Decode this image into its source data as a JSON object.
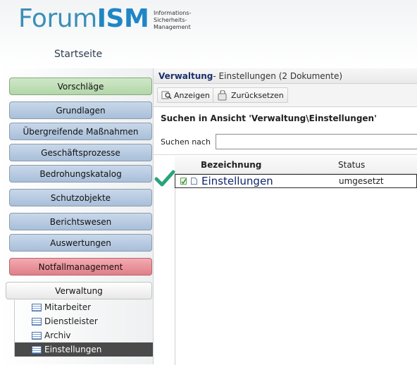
{
  "header": {
    "logo_part1": "Forum",
    "logo_part2": "ISM",
    "logo_sub_line1": "Informations-",
    "logo_sub_line2": "Sicherheits-",
    "logo_sub_line3": "Management",
    "home_link": "Startseite"
  },
  "sidebar": {
    "items": [
      {
        "label": "Vorschläge"
      },
      {
        "label": "Grundlagen"
      },
      {
        "label": "Übergreifende Maßnahmen"
      },
      {
        "label": "Geschäftsprozesse"
      },
      {
        "label": "Bedrohungskatalog"
      },
      {
        "label": "Schutzobjekte"
      },
      {
        "label": "Berichtswesen"
      },
      {
        "label": "Auswertungen"
      },
      {
        "label": "Notfallmanagement"
      },
      {
        "label": "Verwaltung"
      }
    ],
    "subitems": [
      {
        "label": "Mitarbeiter"
      },
      {
        "label": "Dienstleister"
      },
      {
        "label": "Archiv"
      },
      {
        "label": "Einstellungen"
      }
    ]
  },
  "main": {
    "view_title_bold": "Verwaltung",
    "view_title_rest": " - Einstellungen (2 Dokumente)",
    "actions": {
      "show": "Anzeigen",
      "reset": "Zurücksetzen"
    },
    "search_title": "Suchen in Ansicht 'Verwaltung\\Einstellungen'",
    "search_label": "Suchen nach",
    "search_value": "",
    "table": {
      "columns": [
        "Bezeichnung",
        "Status"
      ],
      "rows": [
        {
          "title": "Einstellungen",
          "status": "umgesetzt"
        }
      ]
    }
  },
  "colors": {
    "accent_blue": "#1f86c6",
    "nav_blue": "#b7cbe3",
    "nav_green": "#c0dfb6",
    "nav_red": "#e9929a",
    "check_green": "#2aa37a"
  }
}
